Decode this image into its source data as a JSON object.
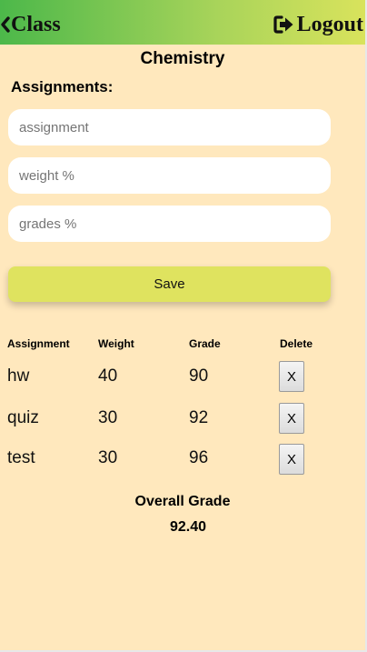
{
  "header": {
    "back_label": "Class",
    "back_icon": "chevron-left-icon",
    "logout_label": "Logout",
    "logout_icon": "sign-out-icon",
    "gradient_colors": [
      "#4cb84a",
      "#d9e35c"
    ]
  },
  "page": {
    "title": "Chemistry",
    "section_title": "Assignments:",
    "background": "#ffe8bd"
  },
  "form": {
    "assignment_placeholder": "assignment",
    "weight_placeholder": "weight %",
    "grade_placeholder": "grades %",
    "assignment_value": "",
    "weight_value": "",
    "grade_value": "",
    "save_label": "Save"
  },
  "table": {
    "headers": [
      "Assignment",
      "Weight",
      "Grade",
      "Delete"
    ],
    "rows": [
      {
        "assignment": "hw",
        "weight": "40",
        "grade": "90",
        "delete_label": "X"
      },
      {
        "assignment": "quiz",
        "weight": "30",
        "grade": "92",
        "delete_label": "X"
      },
      {
        "assignment": "test",
        "weight": "30",
        "grade": "96",
        "delete_label": "X"
      }
    ]
  },
  "summary": {
    "label": "Overall Grade",
    "value": "92.40"
  }
}
